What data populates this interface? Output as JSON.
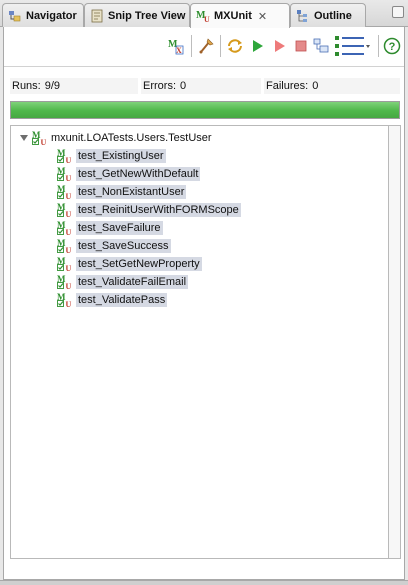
{
  "tabs": [
    {
      "label": "Navigator",
      "icon": "navigator-icon",
      "active": false
    },
    {
      "label": "Snip Tree View",
      "icon": "snip-tree-icon",
      "active": false
    },
    {
      "label": "MXUnit",
      "icon": "mxunit-icon",
      "active": true,
      "close": "✕"
    },
    {
      "label": "Outline",
      "icon": "outline-icon",
      "active": false
    }
  ],
  "toolbar": {
    "icons": [
      "mxunit-run-icon",
      "sweep-icon",
      "rerun-icon",
      "run-icon",
      "run-failed-icon",
      "stop-icon",
      "history-icon",
      "layout-menu-icon",
      "help-icon"
    ],
    "colors": {
      "run": "#2ea73b",
      "run_failed": "#e95252",
      "stop": "#e06060",
      "help": "#2e8b2e"
    }
  },
  "counters": {
    "runs_label": "Runs:",
    "runs_value": "9/9",
    "errors_label": "Errors:",
    "errors_value": "0",
    "failures_label": "Failures:",
    "failures_value": "0"
  },
  "progress": {
    "fraction": 1.0,
    "color": "#4fb74a"
  },
  "tree": {
    "root": "mxunit.LOATests.Users.TestUser",
    "tests": [
      "test_ExistingUser",
      "test_GetNewWithDefault",
      "test_NonExistantUser",
      "test_ReinitUserWithFORMScope",
      "test_SaveFailure",
      "test_SaveSuccess",
      "test_SetGetNewProperty",
      "test_ValidateFailEmail",
      "test_ValidatePass"
    ]
  }
}
